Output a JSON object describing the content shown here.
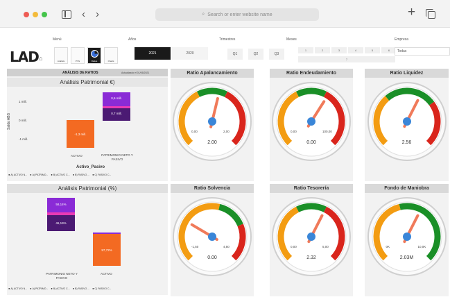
{
  "browser": {
    "address_placeholder": "Search or enter website name"
  },
  "slicers": {
    "menu_label": "Menú",
    "years_label": "Años",
    "quarters_label": "Trimestres",
    "months_label": "Meses",
    "company_label": "Empresa",
    "logo": "LAD",
    "menu_items": [
      "Análisis",
      "PYG",
      "Ratios",
      "Charts"
    ],
    "years": [
      "2021",
      "2020"
    ],
    "quarters": [
      "Q1",
      "Q2",
      "Q3"
    ],
    "months": [
      "1",
      "2",
      "3",
      "4",
      "5",
      "6",
      "7"
    ],
    "company_value": "Todas"
  },
  "ratios_header": {
    "title": "ANÁLISIS DE RATIOS",
    "updated": "Actualizado el 01/06/2021"
  },
  "patrimonial_abs": {
    "title": "Análisis Patrimonial €)",
    "ylabel": "Saldo ABS",
    "xlabel": "Activo_Pasivo",
    "ticks": [
      "1 mill.",
      "0 mill.",
      "-1 mill."
    ],
    "bars": [
      {
        "label": "ACTIVO",
        "value": "-1,3 mill."
      },
      {
        "label": "PATRIMONIO NETO Y PASIVO",
        "segments": [
          "0,6 mill.",
          "0,7 mill."
        ]
      }
    ],
    "legend": [
      "A) ACTIVO N...",
      "A) PATRIMO...",
      "B) ACTIVO C...",
      "B) PASIVO ...",
      "C) PASIVO C..."
    ]
  },
  "patrimonial_pct": {
    "title": "Análisis Patrimonial (%)",
    "bars": [
      {
        "label": "PATRIMONIO NETO Y PASIVO",
        "segments": [
          "58,14%",
          "46,19%"
        ]
      },
      {
        "label": "ACTIVO",
        "value": "97,72%"
      }
    ],
    "legend": [
      "A) ACTIVO N...",
      "A) PATRIMO...",
      "B) ACTIVO C...",
      "B) PASIVO ...",
      "C) PASIVO C..."
    ]
  },
  "gauges": [
    {
      "title": "Ratio Apalancamiento",
      "min": "0,00",
      "max": "2,00",
      "value": "2.00",
      "needle": 0.55
    },
    {
      "title": "Ratio Endeudamiento",
      "min": "0,00",
      "max": "100,00",
      "value": "0.00",
      "needle": 0.62
    },
    {
      "title": "Ratio Liquidez",
      "min": "",
      "max": "",
      "value": "2.56",
      "needle": 0.6
    },
    {
      "title": "Ratio Solvencia",
      "min": "-1,50",
      "max": "4,50",
      "value": "0.00",
      "needle": 0.28
    },
    {
      "title": "Ratio Tesorería",
      "min": "0,00",
      "max": "5,00",
      "value": "2.32",
      "needle": 0.6
    },
    {
      "title": "Fondo de Maniobra",
      "min": "0K",
      "max": "10,0K",
      "value": "2.03M",
      "needle": 0.6
    }
  ],
  "colors": {
    "orange": "#f39c12",
    "red": "#d9251c",
    "green": "#1a8f27",
    "needle": "#f07a5a",
    "hub": "#3a86d8",
    "purple_dark": "#4b1a73",
    "purple": "#8a2bd6",
    "pink": "#e93ab5",
    "activo_orange": "#f36a22"
  }
}
